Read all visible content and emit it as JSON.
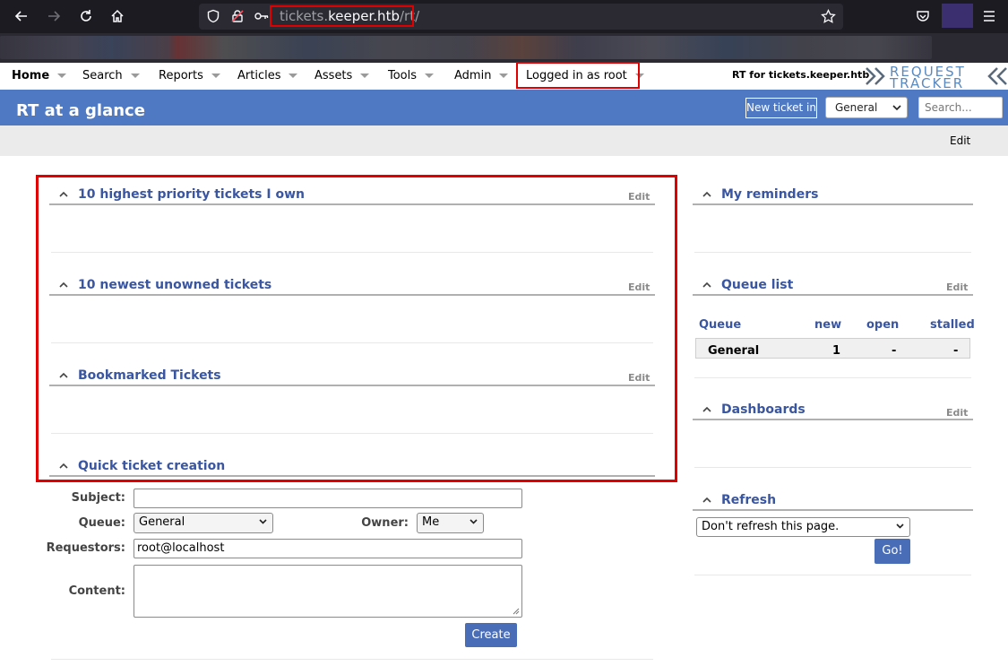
{
  "browser": {
    "url_domain_dim": "tickets.",
    "url_domain": "keeper.htb",
    "url_path": "/rt/"
  },
  "menu": {
    "items": [
      "Home",
      "Search",
      "Reports",
      "Articles",
      "Assets",
      "Tools",
      "Admin",
      "Logged in as root"
    ],
    "rt_for": "RT for tickets.keeper.htb",
    "logo_top": "REQUEST",
    "logo_bottom": "TRACKER"
  },
  "header": {
    "title": "RT at a glance",
    "new_ticket_label": "New ticket in",
    "queue_selected": "General",
    "search_placeholder": "Search..."
  },
  "subbar": {
    "edit_label": "Edit"
  },
  "left_portlets": {
    "priority_title": "10 highest priority tickets I own",
    "unowned_title": "10 newest unowned tickets",
    "bookmarked_title": "Bookmarked Tickets",
    "quick_title": "Quick ticket creation",
    "edit_label": "Edit"
  },
  "right_portlets": {
    "reminders_title": "My reminders",
    "queue_list_title": "Queue list",
    "dashboards_title": "Dashboards",
    "refresh_title": "Refresh",
    "edit_label": "Edit"
  },
  "queue_list": {
    "headers": [
      "Queue",
      "new",
      "open",
      "stalled"
    ],
    "rows": [
      {
        "queue": "General",
        "new": "1",
        "open": "-",
        "stalled": "-"
      }
    ]
  },
  "quick_form": {
    "subject_label": "Subject:",
    "subject_value": "",
    "queue_label": "Queue:",
    "queue_value": "General",
    "owner_label": "Owner:",
    "owner_value": "Me",
    "requestors_label": "Requestors:",
    "requestors_value": "root@localhost",
    "content_label": "Content:",
    "content_value": "",
    "create_label": "Create"
  },
  "refresh": {
    "option_selected": "Don't refresh this page.",
    "go_label": "Go!"
  },
  "colors": {
    "title_bar": "#5079c4",
    "portlet_title": "#3a56a0",
    "highlight": "#e00000",
    "button": "#4a6db8"
  }
}
